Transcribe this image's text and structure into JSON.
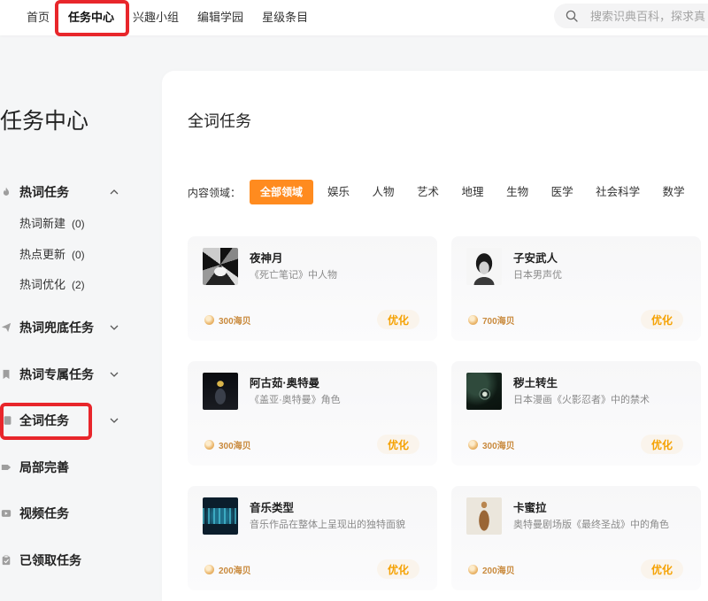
{
  "nav": {
    "items": [
      {
        "label": "首页"
      },
      {
        "label": "任务中心"
      },
      {
        "label": "兴趣小组"
      },
      {
        "label": "编辑学园"
      },
      {
        "label": "星级条目"
      }
    ],
    "active_index": 1,
    "search": {
      "icon": "search-icon",
      "placeholder": "搜索识典百科，探求真"
    }
  },
  "sidebar": {
    "title": "任务中心",
    "items": [
      {
        "label": "热词任务",
        "icon": "fire-icon",
        "chevron": "chevron-up-icon",
        "children": [
          {
            "label": "热词新建",
            "count": "(0)"
          },
          {
            "label": "热点更新",
            "count": "(0)"
          },
          {
            "label": "热词优化",
            "count": "(2)"
          }
        ]
      },
      {
        "label": "热词兜底任务",
        "icon": "paper-plane-icon",
        "chevron": "chevron-down-icon"
      },
      {
        "label": "热词专属任务",
        "icon": "bookmark-icon",
        "chevron": "chevron-down-icon"
      },
      {
        "label": "全词任务",
        "icon": "document-icon",
        "chevron": "chevron-down-icon"
      },
      {
        "label": "局部完善",
        "icon": "tag-icon"
      },
      {
        "label": "视频任务",
        "icon": "video-icon"
      },
      {
        "label": "已领取任务",
        "icon": "clipboard-icon"
      }
    ]
  },
  "main": {
    "title": "全词任务",
    "filter": {
      "label": "内容领域：",
      "options": [
        "全部领域",
        "娱乐",
        "人物",
        "艺术",
        "地理",
        "生物",
        "医学",
        "社会科学",
        "数学"
      ],
      "selected_index": 0
    },
    "reward_icon": "coin-icon",
    "cards": [
      {
        "title": "夜神月",
        "desc": "《死亡笔记》中人物",
        "reward": "300海贝",
        "action": "优化"
      },
      {
        "title": "子安武人",
        "desc": "日本男声优",
        "reward": "700海贝",
        "action": "优化"
      },
      {
        "title": "阿古茹·奥特曼",
        "desc": "《盖亚·奥特曼》角色",
        "reward": "300海贝",
        "action": "优化"
      },
      {
        "title": "秽土转生",
        "desc": "日本漫画《火影忍者》中的禁术",
        "reward": "300海贝",
        "action": "优化"
      },
      {
        "title": "音乐类型",
        "desc": "音乐作品在整体上呈现出的独特面貌",
        "reward": "200海贝",
        "action": "优化"
      },
      {
        "title": "卡蜜拉",
        "desc": "奥特曼剧场版《最终圣战》中的角色",
        "reward": "200海贝",
        "action": "优化"
      }
    ]
  },
  "colors": {
    "accent": "#ff8b1f",
    "action": "#f5a100",
    "reward": "#c98a3d",
    "annotation": "#e8262b"
  }
}
